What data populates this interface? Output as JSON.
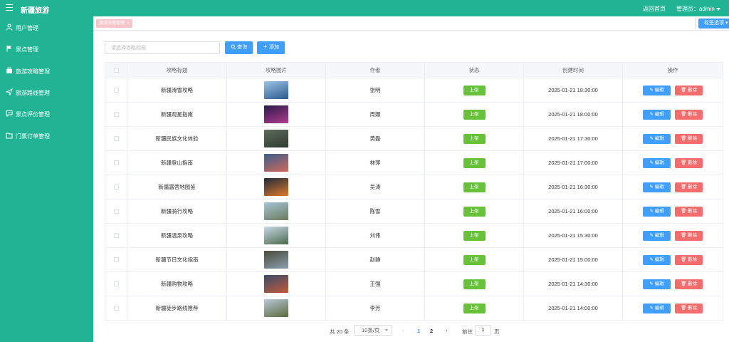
{
  "header": {
    "app_title": "新疆旅游",
    "home_link": "返回首页",
    "admin_label": "管理员：admin"
  },
  "sidebar": {
    "items": [
      {
        "label": "用户管理",
        "icon": "user-icon"
      },
      {
        "label": "景点管理",
        "icon": "flag-icon"
      },
      {
        "label": "旅游攻略管理",
        "icon": "book-icon"
      },
      {
        "label": "旅游路线管理",
        "icon": "send-icon"
      },
      {
        "label": "景点评价管理",
        "icon": "comment-icon"
      },
      {
        "label": "门票订单管理",
        "icon": "folder-icon"
      }
    ]
  },
  "tabs": {
    "active_tag": "旅游攻略管理",
    "options_label": "标签选项"
  },
  "toolbar": {
    "search_placeholder": "请选择攻略标题",
    "query_label": "查询",
    "add_label": "添加"
  },
  "table": {
    "headers": [
      "攻略标题",
      "攻略图片",
      "作者",
      "状态",
      "创建时间",
      "操作"
    ],
    "edit_label": "编辑",
    "delete_label": "删除",
    "rows": [
      {
        "title": "新疆滑雪攻略",
        "author": "张明",
        "status": "上架",
        "created": "2025-01-21 18:30:00",
        "img": [
          "#9bc3e6",
          "#2a5a8c"
        ]
      },
      {
        "title": "新疆观星指南",
        "author": "周娜",
        "status": "上架",
        "created": "2025-01-21 18:00:00",
        "img": [
          "#2b1a4a",
          "#b03a8c"
        ]
      },
      {
        "title": "新疆民族文化体验",
        "author": "黄磊",
        "status": "上架",
        "created": "2025-01-21 17:30:00",
        "img": [
          "#5d6b5a",
          "#2e3b30"
        ]
      },
      {
        "title": "新疆登山指南",
        "author": "林萍",
        "status": "上架",
        "created": "2025-01-21 17:00:00",
        "img": [
          "#3a5d8a",
          "#d06a5a"
        ]
      },
      {
        "title": "新疆露营地图鉴",
        "author": "吴涛",
        "status": "上架",
        "created": "2025-01-21 16:30:00",
        "img": [
          "#1e2a3a",
          "#e07a2a"
        ]
      },
      {
        "title": "新疆骑行攻略",
        "author": "陈雪",
        "status": "上架",
        "created": "2025-01-21 16:00:00",
        "img": [
          "#a6c4d8",
          "#6a7a5a"
        ]
      },
      {
        "title": "新疆温泉攻略",
        "author": "刘伟",
        "status": "上架",
        "created": "2025-01-21 15:30:00",
        "img": [
          "#c8d8e8",
          "#4a6a4a"
        ]
      },
      {
        "title": "新疆节日文化指南",
        "author": "赵静",
        "status": "上架",
        "created": "2025-01-21 15:00:00",
        "img": [
          "#4a4a3a",
          "#8aa0b0"
        ]
      },
      {
        "title": "新疆购物攻略",
        "author": "王强",
        "status": "上架",
        "created": "2025-01-21 14:30:00",
        "img": [
          "#3a4a6a",
          "#c05a3a"
        ]
      },
      {
        "title": "新疆徒步路线推荐",
        "author": "李芳",
        "status": "上架",
        "created": "2025-01-21 14:00:00",
        "img": [
          "#b8c8d8",
          "#5a6a3a"
        ]
      }
    ]
  },
  "pagination": {
    "total": "共 20 条",
    "page_size": "10条/页",
    "pages": [
      "1",
      "2"
    ],
    "current_page": "1",
    "goto_label": "前往",
    "goto_value": "1",
    "goto_suffix": "页"
  },
  "colors": {
    "brand": "#20b494",
    "primary": "#409eff",
    "success": "#67c23a",
    "danger": "#f56c6c"
  }
}
